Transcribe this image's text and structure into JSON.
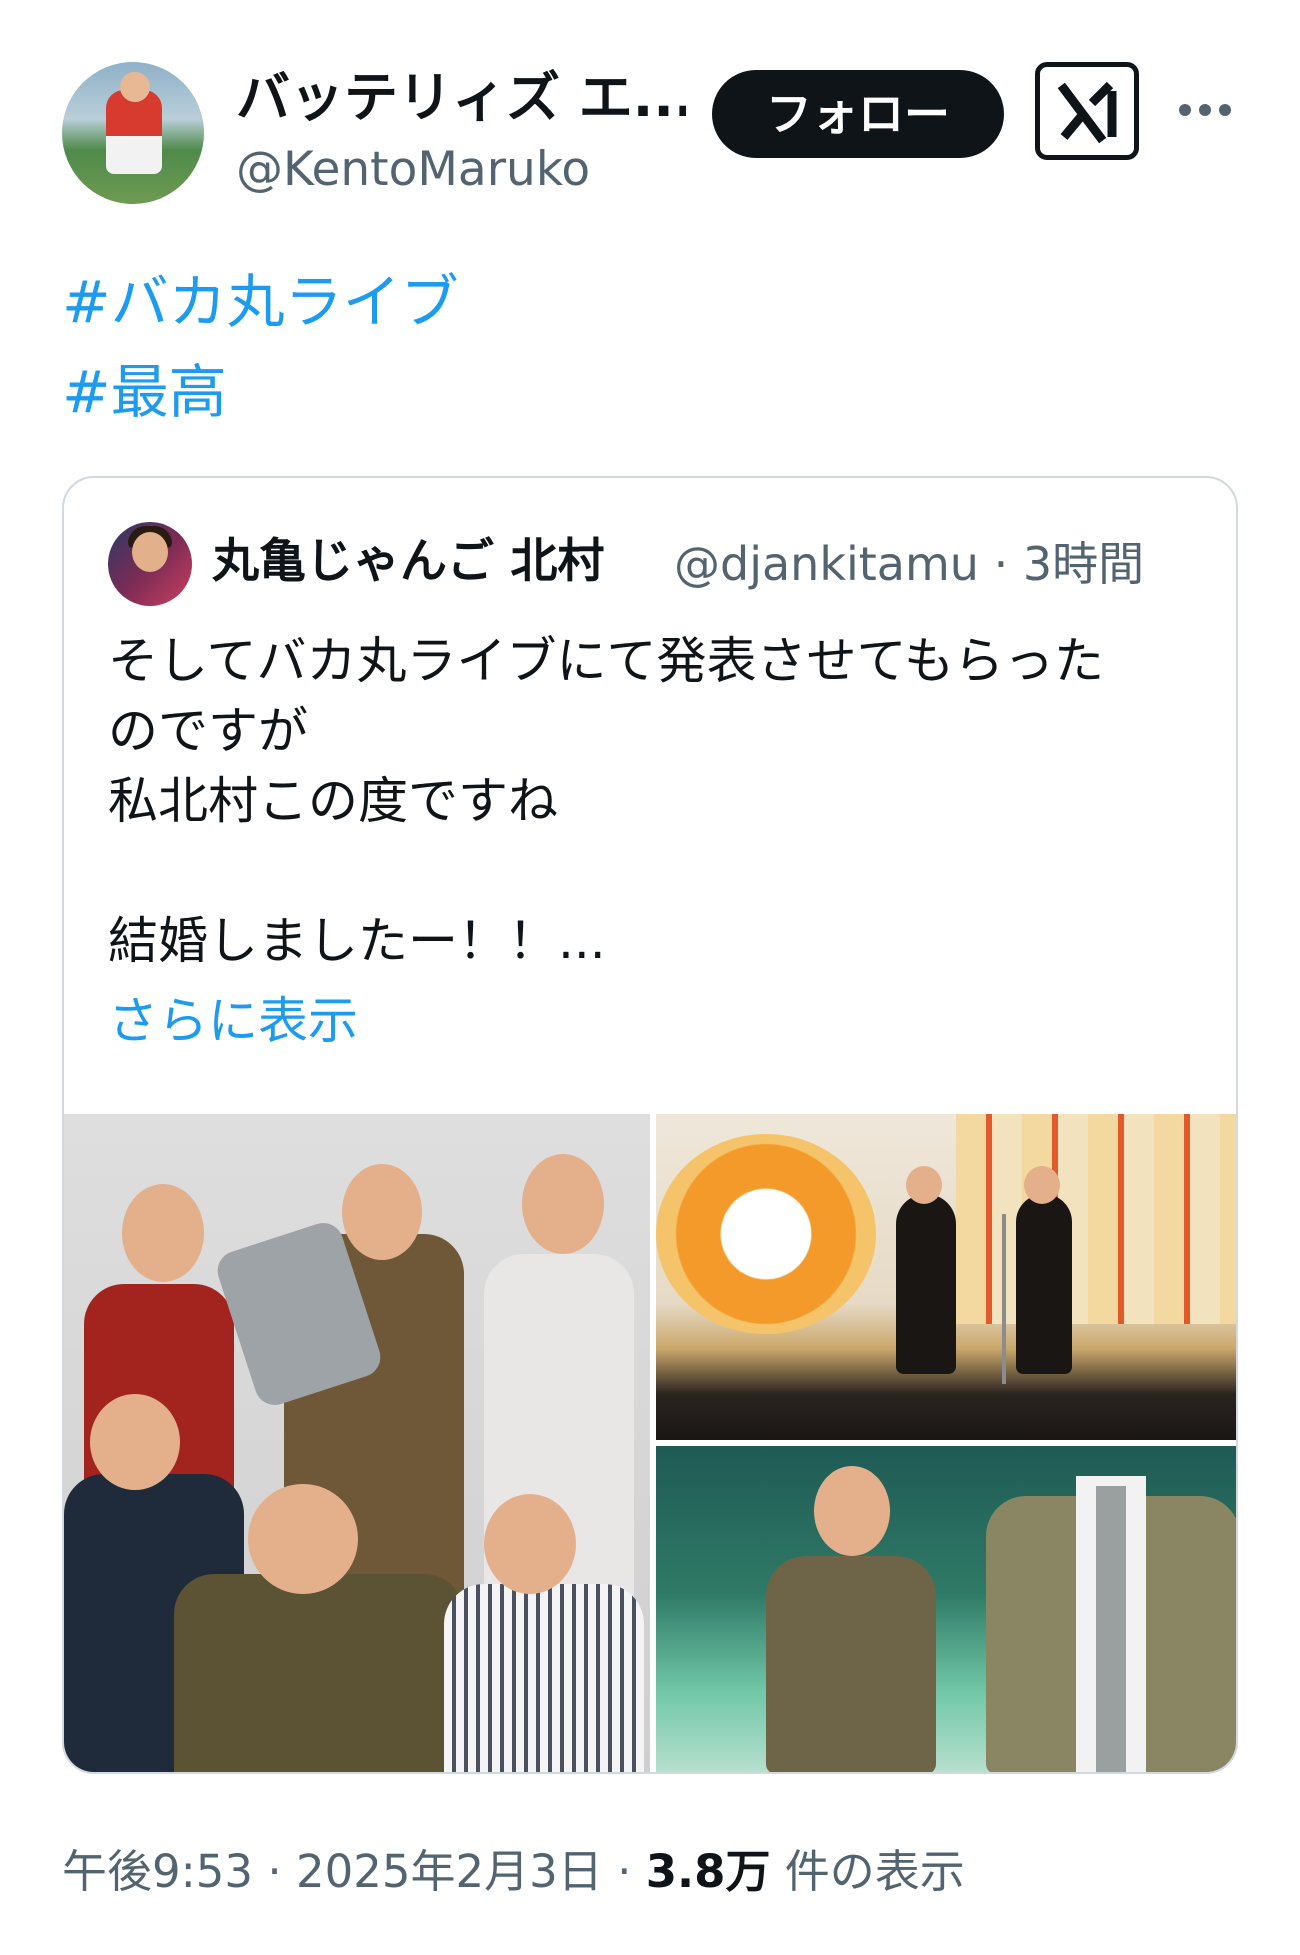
{
  "author": {
    "display_name": "バッテリィズ エ...",
    "handle": "@KentoMaruko",
    "follow_label": "フォロー",
    "grok_icon": "grok-icon",
    "more_icon": "more-dots-icon"
  },
  "tweet": {
    "hashtags": [
      "#バカ丸ライブ",
      "#最高"
    ]
  },
  "quoted": {
    "display_name": "丸亀じゃんご 北村",
    "handle": "@djankitamu",
    "meta_separator": "·",
    "time": "3時間",
    "text": "そしてバカ丸ライブにて発表させてもらった\nのですが\n私北村この度ですね\n\n結婚しましたー！！...",
    "show_more": "さらに表示"
  },
  "footer": {
    "time": "午後9:53",
    "sep1": "·",
    "date": "2025年2月3日",
    "sep2": "·",
    "views_count": "3.8万",
    "views_label": "件の表示"
  },
  "colors": {
    "link": "#1d9bf0",
    "text": "#0f1419",
    "secondary": "#536471",
    "border": "#cfd9de"
  }
}
